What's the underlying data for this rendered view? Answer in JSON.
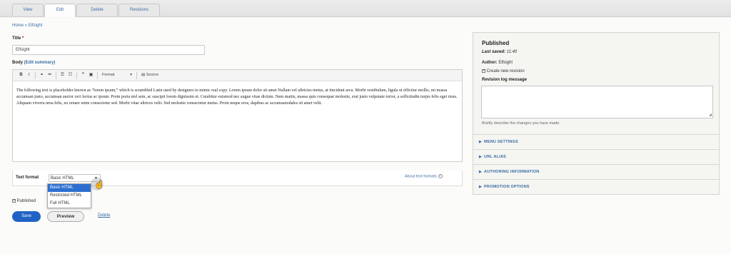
{
  "tabs": [
    "View",
    "Edit",
    "Delete",
    "Revisions"
  ],
  "breadcrumb": "Home » Elfsight",
  "title_field": {
    "label": "Title",
    "required_mark": "*",
    "value": "Elfsight"
  },
  "body_field": {
    "label": "Body",
    "edit_summary": "(Edit summary)"
  },
  "toolbar": {
    "format_label": "Format",
    "source_label": "Source"
  },
  "body_text": "The following text is placeholder known as “lorem ipsum,” which is scrambled Latin used by designers to mimic real copy. Lorem ipsum dolor sit amet Nullam vel ultricies metus, at tincidunt arcu. Morbi vestibulum, ligula ut efficitur mollis, mi massa accumsan justo, accumsan auctor orci lectus ac ipsum. Proin porta nisl sem, ac suscipit lorem dignissim et. Curabitur euismod nec augue vitae dictum. Nam mattis, massa quis consequat molestie, erat justo vulputate tortor, a sollicitudin turpis felis eget risus. Aliquam viverra urna felis, eu ornare enim consectetur sed. Morbi vitae ultrices velit. Sed molestie consectetur metus. Proin neque eros, dapibus ac accumsanodales sit amet velit.",
  "text_format": {
    "label": "Text format",
    "selected": "Basic HTML",
    "options": [
      "Basic HTML",
      "Restricted HTML",
      "Full HTML"
    ],
    "help_link": "About text formats"
  },
  "published_checkbox": "Published",
  "buttons": {
    "save": "Save",
    "preview": "Preview",
    "delete": "Delete"
  },
  "sidebar": {
    "status": "Published",
    "last_saved_label": "Last saved:",
    "last_saved_value": "11:40",
    "author_label": "Author:",
    "author_value": "Elfsight",
    "create_revision": "Create new revision",
    "revision_log_label": "Revision log message",
    "revision_log_desc": "Briefly describe the changes you have made.",
    "sections": [
      "MENU SETTINGS",
      "URL ALIAS",
      "AUTHORING INFORMATION",
      "PROMOTION OPTIONS"
    ]
  },
  "colors": {
    "accent_link": "#3a6ea5",
    "primary_button": "#2063c5",
    "selected_option": "#2d6fd0"
  }
}
